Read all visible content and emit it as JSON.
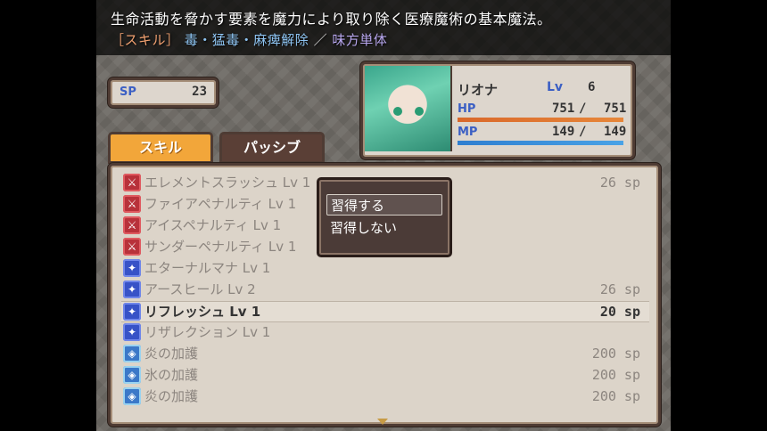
{
  "help": {
    "description": "生命活動を脅かす要素を魔力により取り除く医療魔術の基本魔法。",
    "tag": "［スキル］",
    "effects": "毒・猛毒・麻痺解除",
    "separator": "／",
    "target": "味方単体"
  },
  "sp": {
    "label": "SP",
    "value": "23"
  },
  "actor": {
    "name": "リオナ",
    "level_label": "Lv",
    "level": "6",
    "hp_label": "HP",
    "hp_current": "751",
    "hp_max": "751",
    "hp_ratio": 1.0,
    "mp_label": "MP",
    "mp_current": "149",
    "mp_max": "149",
    "mp_ratio": 1.0,
    "slash": "/"
  },
  "tabs": {
    "skill": "スキル",
    "passive": "パッシブ"
  },
  "skills": [
    {
      "name": "エレメントスラッシュ Lv 1",
      "cost": "26 sp",
      "icon": "sword-icon",
      "icon_glyph": "⚔",
      "color": "red"
    },
    {
      "name": "ファイアペナルティ Lv 1",
      "cost": "",
      "icon": "sword-icon",
      "icon_glyph": "⚔",
      "color": "red"
    },
    {
      "name": "アイスペナルティ Lv 1",
      "cost": "",
      "icon": "sword-icon",
      "icon_glyph": "⚔",
      "color": "red"
    },
    {
      "name": "サンダーペナルティ Lv 1",
      "cost": "",
      "icon": "sword-icon",
      "icon_glyph": "⚔",
      "color": "red"
    },
    {
      "name": "エターナルマナ Lv 1",
      "cost": "",
      "icon": "magic-icon",
      "icon_glyph": "✦",
      "color": "blue"
    },
    {
      "name": "アースヒール Lv 2",
      "cost": "26 sp",
      "icon": "magic-icon",
      "icon_glyph": "✦",
      "color": "blue"
    },
    {
      "name": "リフレッシュ Lv 1",
      "cost": "20 sp",
      "icon": "magic-icon",
      "icon_glyph": "✦",
      "color": "blue",
      "active": true
    },
    {
      "name": "リザレクション Lv 1",
      "cost": "",
      "icon": "magic-icon",
      "icon_glyph": "✦",
      "color": "blue"
    },
    {
      "name": "炎の加護",
      "cost": "200 sp",
      "icon": "shield-icon",
      "icon_glyph": "◈",
      "color": "aqua"
    },
    {
      "name": "氷の加護",
      "cost": "200 sp",
      "icon": "shield-icon",
      "icon_glyph": "◈",
      "color": "aqua"
    },
    {
      "name": "炎の加護",
      "cost": "200 sp",
      "icon": "shield-icon",
      "icon_glyph": "◈",
      "color": "aqua"
    }
  ],
  "popup": {
    "learn": "習得する",
    "not_learn": "習得しない"
  },
  "colors": {
    "hp_gauge": "#e7873a",
    "mp_gauge": "#4aa3e6",
    "accent_tab": "#f2a63a"
  }
}
